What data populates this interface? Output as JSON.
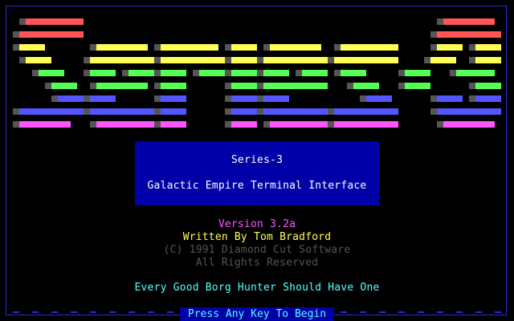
{
  "title_box": {
    "series": "Series-3",
    "subtitle": "Galactic Empire Terminal Interface"
  },
  "credits": {
    "version": "Version 3.2a",
    "author": "Written By Tom Bradford",
    "copyright": "(C) 1991 Diamond Cut Software",
    "rights": "All Rights Reserved"
  },
  "motto": "Every Good Borg Hunter Should Have One",
  "prompt": {
    "press_key": "Press Any Key To Begin"
  },
  "colors": {
    "background": "#000000",
    "title_box": "#0000a8",
    "frame": "#2a2acf",
    "logo_red": "#ff5555",
    "logo_yellow": "#ffff55",
    "logo_green": "#55ff55",
    "logo_blue": "#5555ff",
    "logo_magenta": "#ff55ff",
    "logo_cap": "#555555",
    "version_text": "#ff55ff",
    "author_text": "#ffff55",
    "copyright_text": "#555555",
    "motto_text": "#55ffff"
  }
}
